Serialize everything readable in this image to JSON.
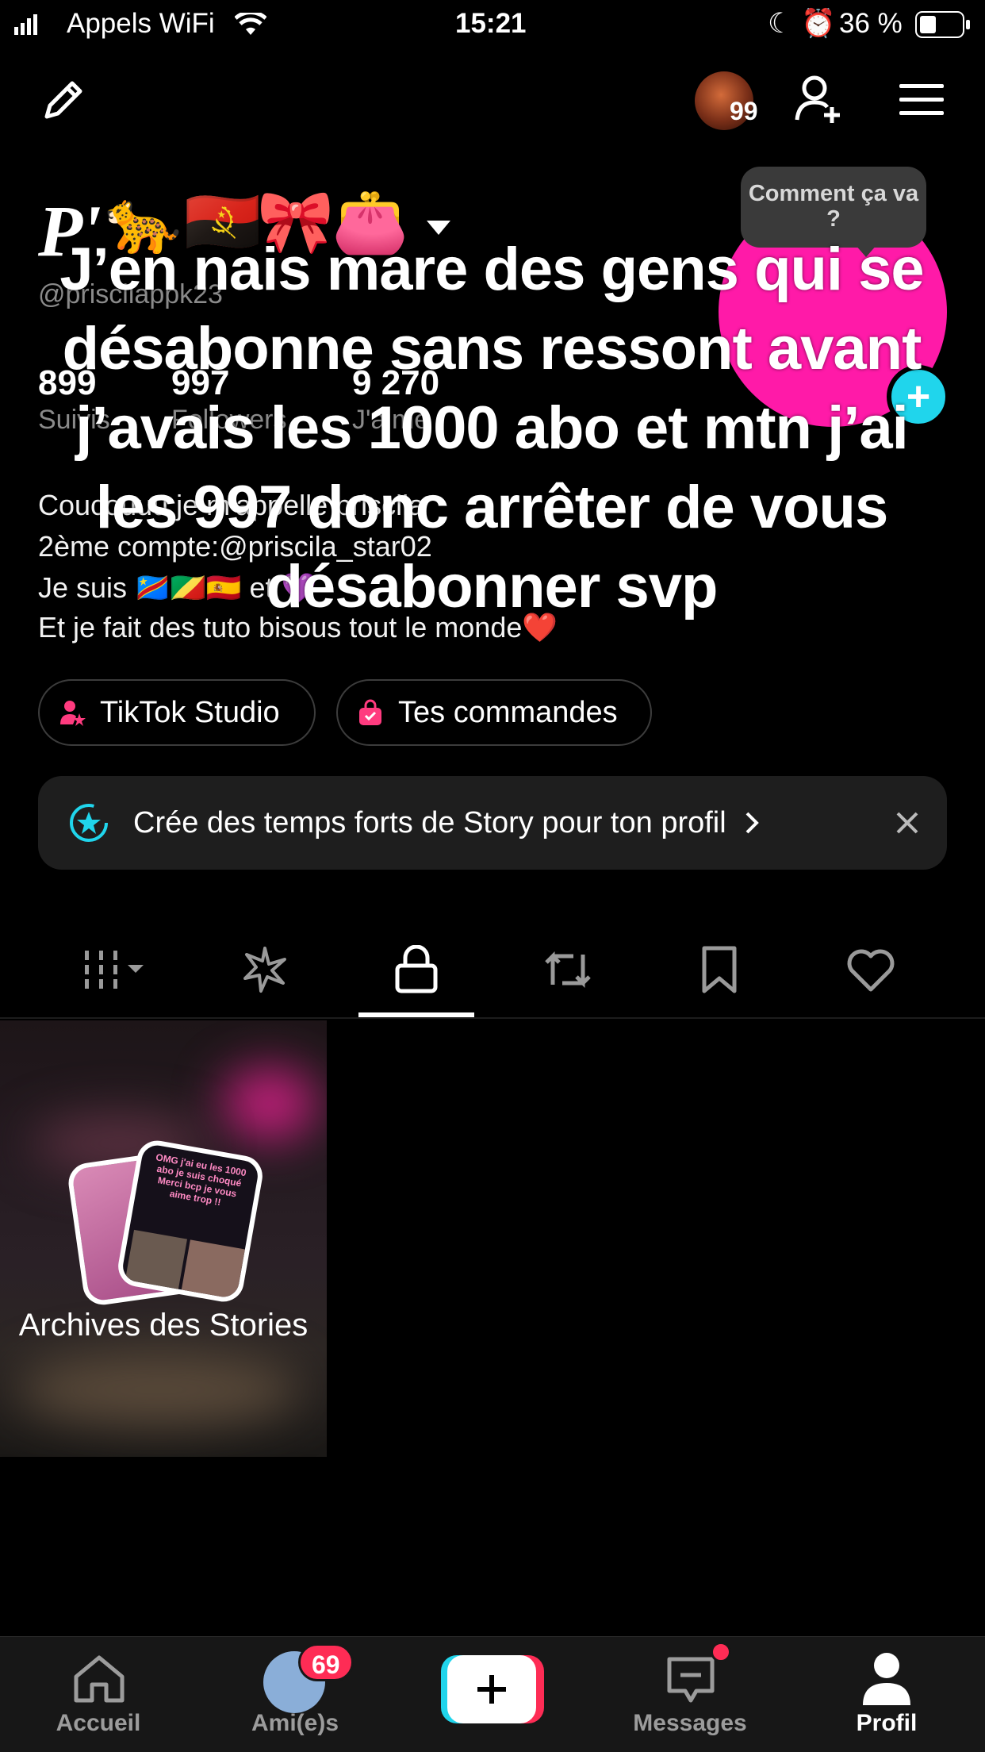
{
  "status_bar": {
    "carrier": "Appels WiFi",
    "time": "15:21",
    "battery": "36 %"
  },
  "header": {
    "notification_count": "99"
  },
  "profile": {
    "display_name": "P'",
    "name_emojis": [
      "🐆",
      "🇦🇴",
      "🎀",
      "👛"
    ],
    "username": "@priscilappk23",
    "stats": [
      {
        "value": "899",
        "label": "Suivis"
      },
      {
        "value": "997",
        "label": "Followers"
      },
      {
        "value": "9 270",
        "label": "J'aime"
      }
    ],
    "bio_lines": [
      "Coucouuu je m'appelle priscila",
      "2ème compte:@priscila_star02",
      "Je suis 🇨🇩🇨🇬🇪🇸 et 💜",
      "Et je fait des tuto bisous tout le monde❤️"
    ]
  },
  "story_bubble": "Comment ça va ?",
  "overlay_text": "J’en nais mare des gens qui se désabonne sans ressont avant j’avais les 1000 abo et mtn j’ai les 997 donc arrêter de vous désabonner svp",
  "buttons": {
    "studio": "TikTok Studio",
    "orders": "Tes commandes"
  },
  "banner": {
    "text": "Crée des temps forts de Story pour ton profil"
  },
  "tabs": [
    "videos",
    "highlights",
    "private",
    "reposts",
    "saved",
    "liked"
  ],
  "archive": {
    "title": "Archives des Stories",
    "thumb_text": "OMG j'ai eu les 1000 abo je suis choqué Merci bcp je vous aime trop !!"
  },
  "bottom_nav": {
    "home": "Accueil",
    "friends": "Ami(e)s",
    "friends_badge": "69",
    "messages": "Messages",
    "profile": "Profil"
  },
  "colors": {
    "accent_pink": "#ff1aa8",
    "accent_cyan": "#20d5ec",
    "badge_red": "#fe2c55"
  }
}
